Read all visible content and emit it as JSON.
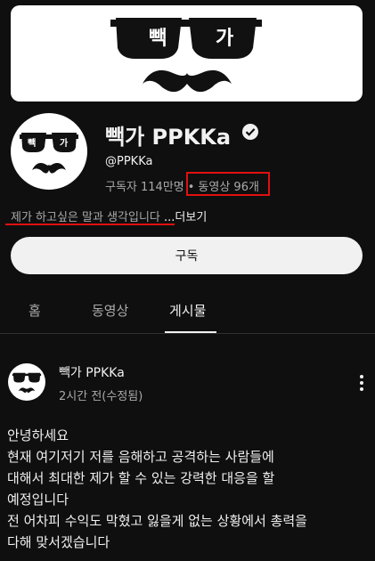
{
  "banner": {
    "logo_text_left": "빽",
    "logo_text_right": "가"
  },
  "channel": {
    "name": "빽가 PPKKa",
    "handle": "@PPKKa",
    "subscribers": "구독자 114만명",
    "separator": "•",
    "videos": "동영상 96개",
    "description": "제가 하고싶은 말과 생각입니다 ",
    "more_label": "...더보기",
    "verified_icon": "verified-check-icon"
  },
  "subscribe_label": "구독",
  "tabs": [
    {
      "label": "홈",
      "active": false
    },
    {
      "label": "동영상",
      "active": false
    },
    {
      "label": "게시물",
      "active": true
    }
  ],
  "post": {
    "author": "빽가 PPKKa",
    "time": "2시간 전(수정됨)",
    "menu_icon": "more-vert-icon",
    "lines": [
      "안녕하세요",
      "현재 여기저기 저를 음해하고 공격하는 사람들에",
      "대해서 최대한 제가 할 수 있는 강력한 대응을 할",
      "예정입니다",
      "전 어차피 수익도 막혔고  잃을게 없는 상황에서 총력을",
      "다해 맞서겠습니다"
    ]
  },
  "colors": {
    "background": "#0f0f0f",
    "highlight": "#e01010",
    "text": "#f1f1f1",
    "muted": "#aaaaaa"
  }
}
